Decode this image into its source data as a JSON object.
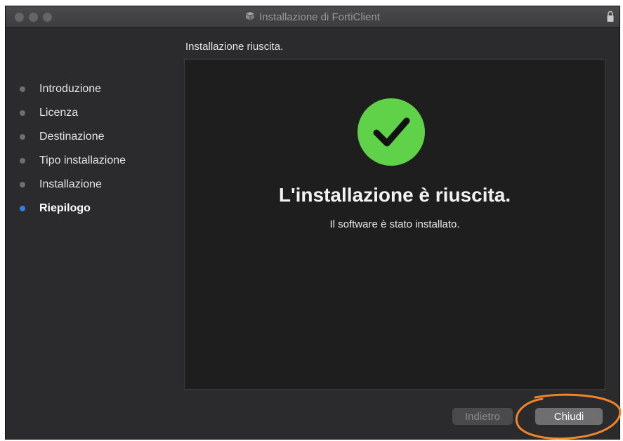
{
  "window": {
    "title": "Installazione di FortiClient",
    "app_icon": "package-icon",
    "lock_icon": "lock-icon"
  },
  "header": {
    "subtitle": "Installazione riuscita."
  },
  "sidebar": {
    "items": [
      {
        "label": "Introduzione",
        "active": false
      },
      {
        "label": "Licenza",
        "active": false
      },
      {
        "label": "Destinazione",
        "active": false
      },
      {
        "label": "Tipo installazione",
        "active": false
      },
      {
        "label": "Installazione",
        "active": false
      },
      {
        "label": "Riepilogo",
        "active": true
      }
    ]
  },
  "main": {
    "status_icon": "checkmark-icon",
    "title": "L'installazione è riuscita.",
    "message": "Il software è stato installato."
  },
  "footer": {
    "back_label": "Indietro",
    "close_label": "Chiudi"
  },
  "colors": {
    "accent": "#2f7fe6",
    "success": "#5fd24a",
    "highlight": "#f0852a"
  }
}
